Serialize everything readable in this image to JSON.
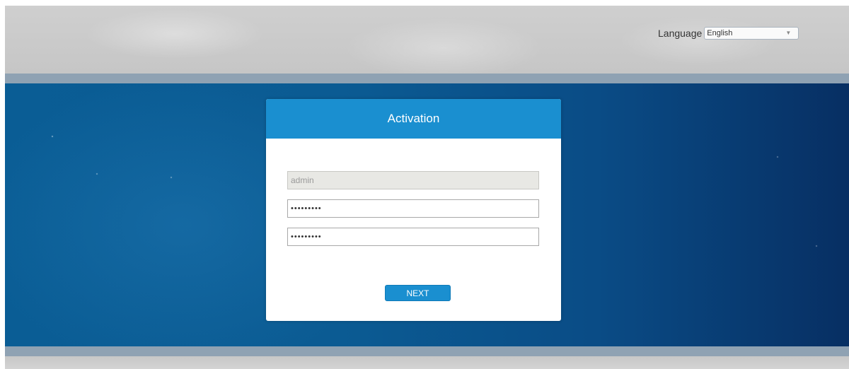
{
  "header": {
    "language_label": "Language",
    "language_selected": "English"
  },
  "dialog": {
    "title": "Activation",
    "username_value": "admin",
    "password_value": "•••••••••",
    "confirm_password_value": "•••••••••",
    "next_label": "NEXT"
  },
  "colors": {
    "accent": "#1a8fd0",
    "background_blue": "#0b5b93"
  },
  "icons": {
    "language_dropdown": "chevron-down-icon"
  }
}
